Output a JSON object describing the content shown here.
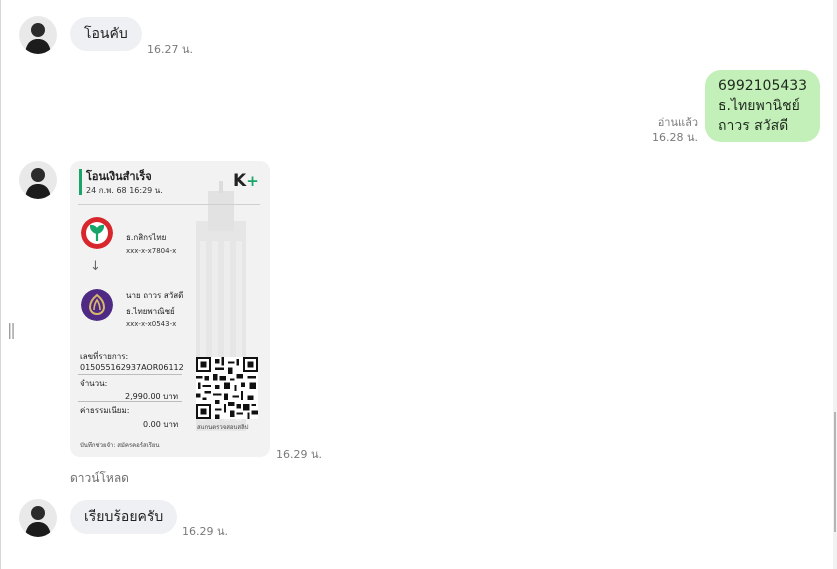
{
  "messages": {
    "m1": {
      "text": "โอนคับ",
      "time": "16.27 น."
    },
    "m2": {
      "lines": [
        "6992105433",
        "ธ.ไทยพานิชย์",
        "ถาวร สวัสดี"
      ],
      "read_status": "อ่านแล้ว",
      "time": "16.28 น."
    },
    "m3": {
      "time": "16.29 น.",
      "download": "ดาวน์โหลด",
      "slip": {
        "title": "โอนเงินสำเร็จ",
        "date": "24 ก.พ. 68  16:29 น.",
        "brand": "K",
        "brand_plus": "+",
        "from_bank": "ธ.กสิกรไทย",
        "from_acc": "xxx-x-x7804-x",
        "to_name": "นาย ถาวร สวัสดี",
        "to_bank": "ธ.ไทยพาณิชย์",
        "to_acc": "xxx-x-x0543-x",
        "ref_label": "เลขที่รายการ:",
        "ref_value": "015055162937AOR06112",
        "amount_label": "จำนวน:",
        "amount_value": "2,990.00 บาท",
        "fee_label": "ค่าธรรมเนียม:",
        "fee_value": "0.00 บาท",
        "qr_caption": "สแกนตรวจสอบสลิป",
        "footer": "บันทึกช่วยจำ: สมัครคอร์สเรียน"
      }
    },
    "m4": {
      "text": "เรียบร้อยครับ",
      "time": "16.29 น."
    }
  },
  "colors": {
    "outgoing_bubble": "#c3efb8",
    "incoming_bubble": "#eef0f3",
    "kbank_green": "#18a56a",
    "scb_purple": "#4e2a84"
  }
}
